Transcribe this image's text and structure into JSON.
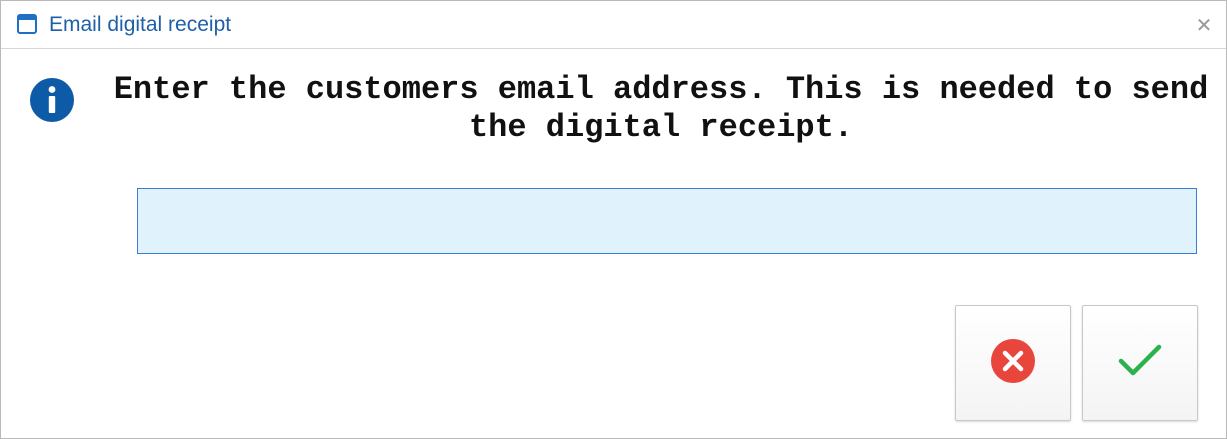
{
  "window": {
    "title": "Email digital receipt",
    "title_icon": "window-icon",
    "close_glyph": "✕"
  },
  "dialog": {
    "info_icon": "info-icon",
    "message": "Enter the customers email address. This is needed to send the digital receipt.",
    "email_input": {
      "value": "",
      "placeholder": ""
    }
  },
  "buttons": {
    "cancel_icon": "cancel-x-icon",
    "confirm_icon": "checkmark-icon"
  },
  "colors": {
    "title_text": "#1f5fa8",
    "info_icon_bg": "#0d5ba6",
    "input_bg": "#e0f3fc",
    "input_border": "#3c7dd0",
    "cancel_red": "#e8463d",
    "confirm_green": "#2bb24c"
  }
}
